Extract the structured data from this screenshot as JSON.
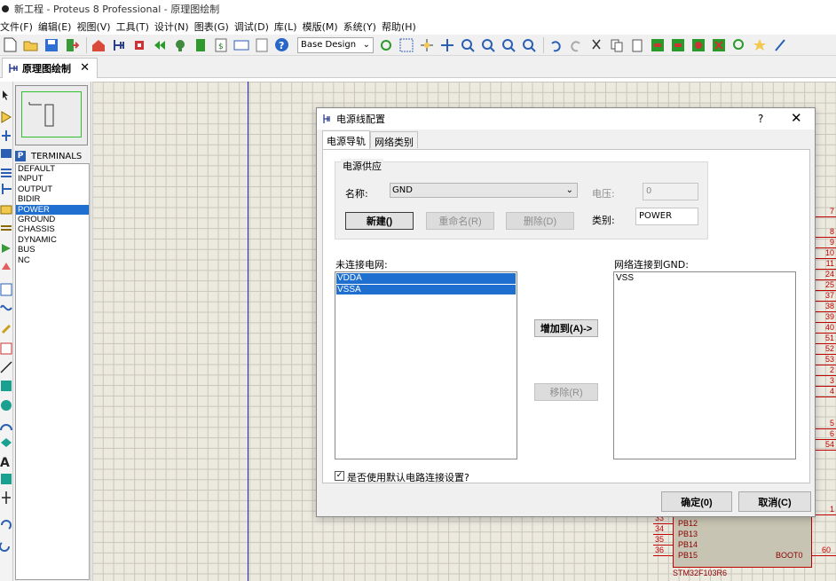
{
  "window": {
    "title": "新工程 - Proteus 8 Professional - 原理图绘制"
  },
  "menu": [
    "文件(F)",
    "编辑(E)",
    "视图(V)",
    "工具(T)",
    "设计(N)",
    "图表(G)",
    "调试(D)",
    "库(L)",
    "模版(M)",
    "系统(Y)",
    "帮助(H)"
  ],
  "toolbar": {
    "design_select": "Base Design"
  },
  "tab": {
    "label": "原理图绘制",
    "close": "✕"
  },
  "terminals": {
    "header_button": "P",
    "title": "TERMINALS",
    "items": [
      "DEFAULT",
      "INPUT",
      "OUTPUT",
      "BIDIR",
      "POWER",
      "GROUND",
      "CHASSIS",
      "DYNAMIC",
      "BUS",
      "NC"
    ],
    "selected": "POWER"
  },
  "schematic": {
    "right_pins": [
      "7",
      "8",
      "9",
      "10",
      "11",
      "24",
      "25",
      "37",
      "38",
      "39",
      "40",
      "51",
      "52",
      "53",
      "2",
      "3",
      "4",
      "5",
      "6",
      "54",
      "1"
    ],
    "chip": {
      "pins": [
        {
          "num": "33",
          "label": "PB12"
        },
        {
          "num": "34",
          "label": "PB13"
        },
        {
          "num": "35",
          "label": "PB14"
        },
        {
          "num": "36",
          "label": "PB15"
        }
      ],
      "right_label": "BOOT0",
      "right_num": "60",
      "name": "STM32F103R6"
    }
  },
  "dialog": {
    "title": "电源线配置",
    "help": "?",
    "close": "✕",
    "tabs": [
      "电源导轨",
      "网络类别"
    ],
    "group_title": "电源供应",
    "name_label": "名称:",
    "name_value": "GND",
    "voltage_label": "电压:",
    "voltage_value": "0",
    "class_label": "类别:",
    "class_value": "POWER",
    "new_button": "新建()",
    "rename_button": "重命名(R)",
    "delete_button": "删除(D)",
    "unconnected_label": "未连接电网:",
    "unconnected_nets": [
      "VDDA",
      "VSSA"
    ],
    "connected_label": "网络连接到GND:",
    "connected_nets": [
      "VSS"
    ],
    "add_button": "增加到(A)->",
    "remove_button": "移除(R)",
    "default_checkbox_label": "是否使用默认电路连接设置?",
    "ok_button": "确定(0)",
    "cancel_button": "取消(C)"
  }
}
